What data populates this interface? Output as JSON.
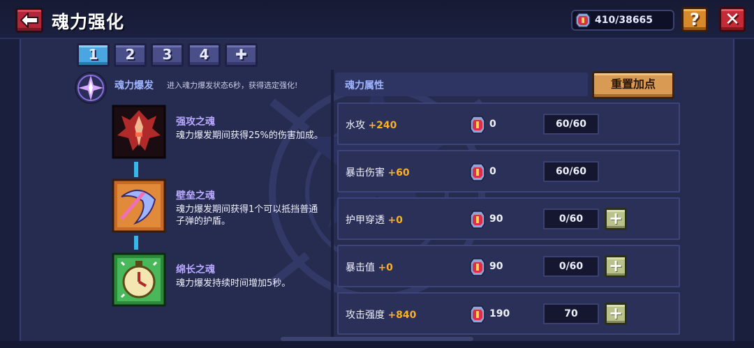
{
  "header": {
    "title": "魂力强化",
    "currency": {
      "icon": "soul-gem-icon",
      "value": "410/38665"
    },
    "help_label": "?",
    "close_label": "✕"
  },
  "tabs": [
    {
      "label": "1",
      "active": true
    },
    {
      "label": "2",
      "active": false
    },
    {
      "label": "3",
      "active": false
    },
    {
      "label": "4",
      "active": false
    },
    {
      "label": "✚",
      "active": false
    }
  ],
  "burst": {
    "title": "魂力爆发",
    "description": "进入魂力爆发状态6秒，获得选定强化!"
  },
  "souls": [
    {
      "name": "强攻之魂",
      "description": "魂力爆发期间获得25%的伤害加成。",
      "icon": "dagger-icon"
    },
    {
      "name": "壁垒之魂",
      "description": "魂力爆发期间获得1个可以抵挡普通子弹的护盾。",
      "icon": "shield-icon"
    },
    {
      "name": "绵长之魂",
      "description": "魂力爆发持续时间增加5秒。",
      "icon": "clock-icon"
    }
  ],
  "attributes": {
    "title": "魂力属性",
    "reset_label": "重置加点",
    "rows": [
      {
        "name": "水攻",
        "bonus": "+240",
        "cost": "0",
        "level": "60/60",
        "can_add": false
      },
      {
        "name": "暴击伤害",
        "bonus": "+60",
        "cost": "0",
        "level": "60/60",
        "can_add": false
      },
      {
        "name": "护甲穿透",
        "bonus": "+0",
        "cost": "90",
        "level": "0/60",
        "can_add": true
      },
      {
        "name": "暴击值",
        "bonus": "+0",
        "cost": "90",
        "level": "0/60",
        "can_add": true
      },
      {
        "name": "攻击强度",
        "bonus": "+840",
        "cost": "190",
        "level": "70",
        "can_add": true
      }
    ],
    "plus_label": "+"
  },
  "colors": {
    "bonus": "#ffb020",
    "tab_active": "#4aa6e0",
    "accent_text": "#9fb4ff",
    "connector": "#38b8e8"
  }
}
